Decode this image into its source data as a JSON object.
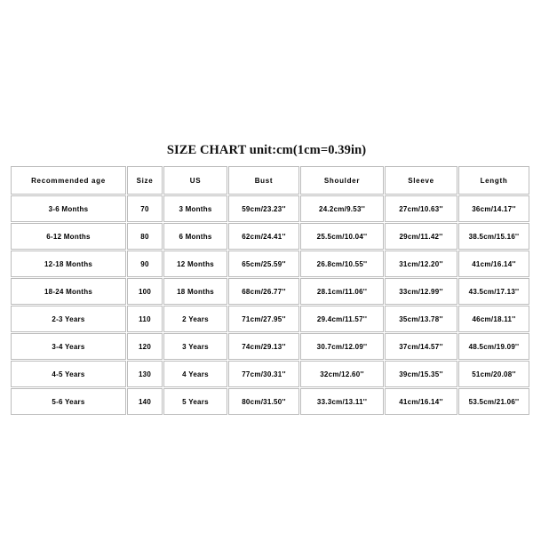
{
  "title": "SIZE CHART unit:cm(1cm=0.39in)",
  "table": {
    "headers": [
      "Recommended age",
      "Size",
      "US",
      "Bust",
      "Shoulder",
      "Sleeve",
      "Length"
    ],
    "rows": [
      [
        "3-6 Months",
        "70",
        "3 Months",
        "59cm/23.23''",
        "24.2cm/9.53''",
        "27cm/10.63''",
        "36cm/14.17''"
      ],
      [
        "6-12 Months",
        "80",
        "6 Months",
        "62cm/24.41''",
        "25.5cm/10.04''",
        "29cm/11.42''",
        "38.5cm/15.16''"
      ],
      [
        "12-18 Months",
        "90",
        "12 Months",
        "65cm/25.59''",
        "26.8cm/10.55''",
        "31cm/12.20''",
        "41cm/16.14''"
      ],
      [
        "18-24 Months",
        "100",
        "18 Months",
        "68cm/26.77''",
        "28.1cm/11.06''",
        "33cm/12.99''",
        "43.5cm/17.13''"
      ],
      [
        "2-3 Years",
        "110",
        "2 Years",
        "71cm/27.95''",
        "29.4cm/11.57''",
        "35cm/13.78''",
        "46cm/18.11''"
      ],
      [
        "3-4 Years",
        "120",
        "3 Years",
        "74cm/29.13''",
        "30.7cm/12.09''",
        "37cm/14.57''",
        "48.5cm/19.09''"
      ],
      [
        "4-5 Years",
        "130",
        "4 Years",
        "77cm/30.31''",
        "32cm/12.60''",
        "39cm/15.35''",
        "51cm/20.08''"
      ],
      [
        "5-6 Years",
        "140",
        "5 Years",
        "80cm/31.50''",
        "33.3cm/13.11''",
        "41cm/16.14''",
        "53.5cm/21.06''"
      ]
    ]
  },
  "colors": {
    "page_background": "#ffffff",
    "cell_background": "#ffffff",
    "cell_border": "#bcbcbc",
    "text": "#000000",
    "title_text": "#111111"
  },
  "chart_data": {
    "type": "table",
    "title": "SIZE CHART unit:cm(1cm=0.39in)",
    "columns": [
      "Recommended age",
      "Size",
      "US",
      "Bust",
      "Shoulder",
      "Sleeve",
      "Length"
    ],
    "units": {
      "note": "1cm=0.39in",
      "primary": "cm",
      "secondary": "in"
    },
    "records": [
      {
        "recommended_age": "3-6 Months",
        "size": 70,
        "us": "3 Months",
        "bust_cm": 59,
        "bust_in": 23.23,
        "shoulder_cm": 24.2,
        "shoulder_in": 9.53,
        "sleeve_cm": 27,
        "sleeve_in": 10.63,
        "length_cm": 36,
        "length_in": 14.17
      },
      {
        "recommended_age": "6-12 Months",
        "size": 80,
        "us": "6 Months",
        "bust_cm": 62,
        "bust_in": 24.41,
        "shoulder_cm": 25.5,
        "shoulder_in": 10.04,
        "sleeve_cm": 29,
        "sleeve_in": 11.42,
        "length_cm": 38.5,
        "length_in": 15.16
      },
      {
        "recommended_age": "12-18 Months",
        "size": 90,
        "us": "12 Months",
        "bust_cm": 65,
        "bust_in": 25.59,
        "shoulder_cm": 26.8,
        "shoulder_in": 10.55,
        "sleeve_cm": 31,
        "sleeve_in": 12.2,
        "length_cm": 41,
        "length_in": 16.14
      },
      {
        "recommended_age": "18-24 Months",
        "size": 100,
        "us": "18 Months",
        "bust_cm": 68,
        "bust_in": 26.77,
        "shoulder_cm": 28.1,
        "shoulder_in": 11.06,
        "sleeve_cm": 33,
        "sleeve_in": 12.99,
        "length_cm": 43.5,
        "length_in": 17.13
      },
      {
        "recommended_age": "2-3 Years",
        "size": 110,
        "us": "2 Years",
        "bust_cm": 71,
        "bust_in": 27.95,
        "shoulder_cm": 29.4,
        "shoulder_in": 11.57,
        "sleeve_cm": 35,
        "sleeve_in": 13.78,
        "length_cm": 46,
        "length_in": 18.11
      },
      {
        "recommended_age": "3-4 Years",
        "size": 120,
        "us": "3 Years",
        "bust_cm": 74,
        "bust_in": 29.13,
        "shoulder_cm": 30.7,
        "shoulder_in": 12.09,
        "sleeve_cm": 37,
        "sleeve_in": 14.57,
        "length_cm": 48.5,
        "length_in": 19.09
      },
      {
        "recommended_age": "4-5 Years",
        "size": 130,
        "us": "4 Years",
        "bust_cm": 77,
        "bust_in": 30.31,
        "shoulder_cm": 32,
        "shoulder_in": 12.6,
        "sleeve_cm": 39,
        "sleeve_in": 15.35,
        "length_cm": 51,
        "length_in": 20.08
      },
      {
        "recommended_age": "5-6 Years",
        "size": 140,
        "us": "5 Years",
        "bust_cm": 80,
        "bust_in": 31.5,
        "shoulder_cm": 33.3,
        "shoulder_in": 13.11,
        "sleeve_cm": 41,
        "sleeve_in": 16.14,
        "length_cm": 53.5,
        "length_in": 21.06
      }
    ]
  }
}
